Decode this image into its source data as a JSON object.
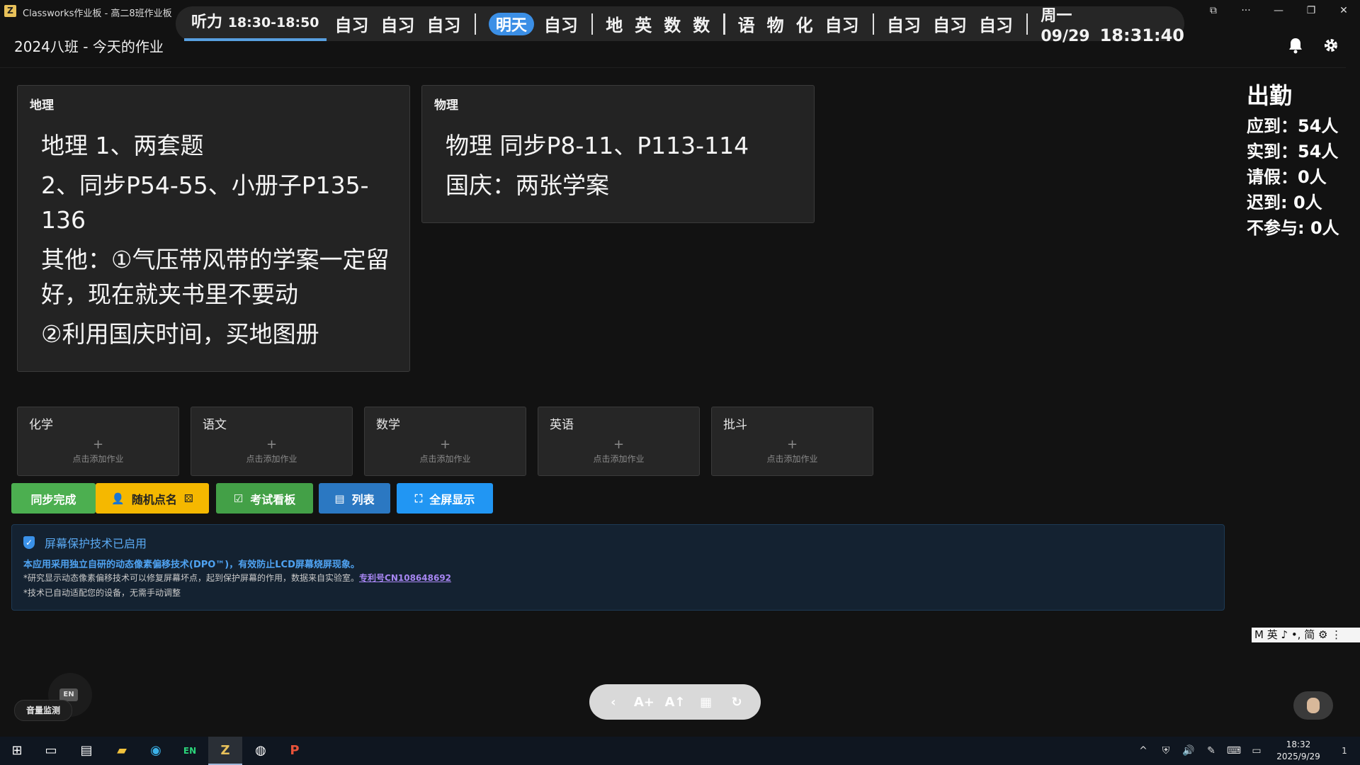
{
  "window": {
    "title": "Classworks作业板 - 高二8班作业板",
    "app_icon": "Z",
    "controls": [
      "⧉",
      "···",
      "—",
      "❐",
      "✕"
    ]
  },
  "schedule": {
    "current": {
      "label": "听力",
      "time": "18:30-18:50"
    },
    "today_rest": [
      "自习",
      "自习",
      "自习"
    ],
    "tomorrow_badge": "明天",
    "group1": [
      "自习"
    ],
    "group2": [
      "地",
      "英",
      "数",
      "数"
    ],
    "group3": [
      "语",
      "物",
      "化",
      "自习"
    ],
    "group4": [
      "自习",
      "自习",
      "自习"
    ],
    "date": "周一 09/29",
    "clock": "18:31:40"
  },
  "header": {
    "title": "2024八班 - 今天的作业",
    "bell_icon": "bell-icon",
    "settings_icon": "gear-icon"
  },
  "homework": [
    {
      "subject": "地理",
      "lines": [
        "地理 1、两套题",
        "2、同步P54-55、小册子P135-136",
        "其他：①气压带风带的学案一定留好，现在就夹书里不要动",
        "②利用国庆时间，买地图册"
      ]
    },
    {
      "subject": "物理",
      "lines": [
        "物理 同步P8-11、P113-114",
        "国庆：两张学案"
      ]
    }
  ],
  "empty_subjects": [
    {
      "subject": "化学",
      "plus": "+",
      "hint": "点击添加作业"
    },
    {
      "subject": "语文",
      "plus": "+",
      "hint": "点击添加作业"
    },
    {
      "subject": "数学",
      "plus": "+",
      "hint": "点击添加作业"
    },
    {
      "subject": "英语",
      "plus": "+",
      "hint": "点击添加作业"
    },
    {
      "subject": "批斗",
      "plus": "+",
      "hint": "点击添加作业"
    }
  ],
  "attendance": {
    "title": "出勤",
    "expected": "应到：54人",
    "actual": "实到：54人",
    "leave": "请假：0人",
    "late": "迟到: 0人",
    "absent": "不参与: 0人"
  },
  "actions": {
    "sync_done": "同步完成",
    "random_call": "随机点名",
    "exam_board": "考试看板",
    "list": "列表",
    "fullscreen": "全屏显示",
    "colors": {
      "sync": "#4caf50",
      "random": "#f5b800",
      "exam": "#43a047",
      "list": "#2b78c2",
      "fullscreen": "#2196f3"
    }
  },
  "screen_protection": {
    "title": "屏幕保护技术已启用",
    "line1": "本应用采用独立自研的动态像素偏移技术(DPO™)，有效防止LCD屏幕烧屏现象。",
    "line2": "*研究显示动态像素偏移技术可以修复屏幕坏点，起到保护屏幕的作用，数据来自实验室。",
    "patent_link": "专利号CN108648692",
    "line3": "*技术已自动适配您的设备，无需手动调整"
  },
  "ime_bar": "M 英 ♪ •, 简 ⚙ ⋮",
  "volume_monitor": {
    "label": "音量监测",
    "badge": "EN"
  },
  "bottom_toolbar": {
    "icons": [
      "‹",
      "A+",
      "A↑",
      "▦",
      "↻"
    ]
  },
  "taskbar": {
    "clock_time": "18:32",
    "clock_date": "2025/9/29",
    "apps": [
      "⊞",
      "▭",
      "▤",
      "▰",
      "◉",
      "EN",
      "Z",
      "◍",
      "P"
    ],
    "tray": [
      "^",
      "⛨",
      "🔊",
      "✎",
      "⌨",
      "▭"
    ],
    "notification": "1"
  }
}
